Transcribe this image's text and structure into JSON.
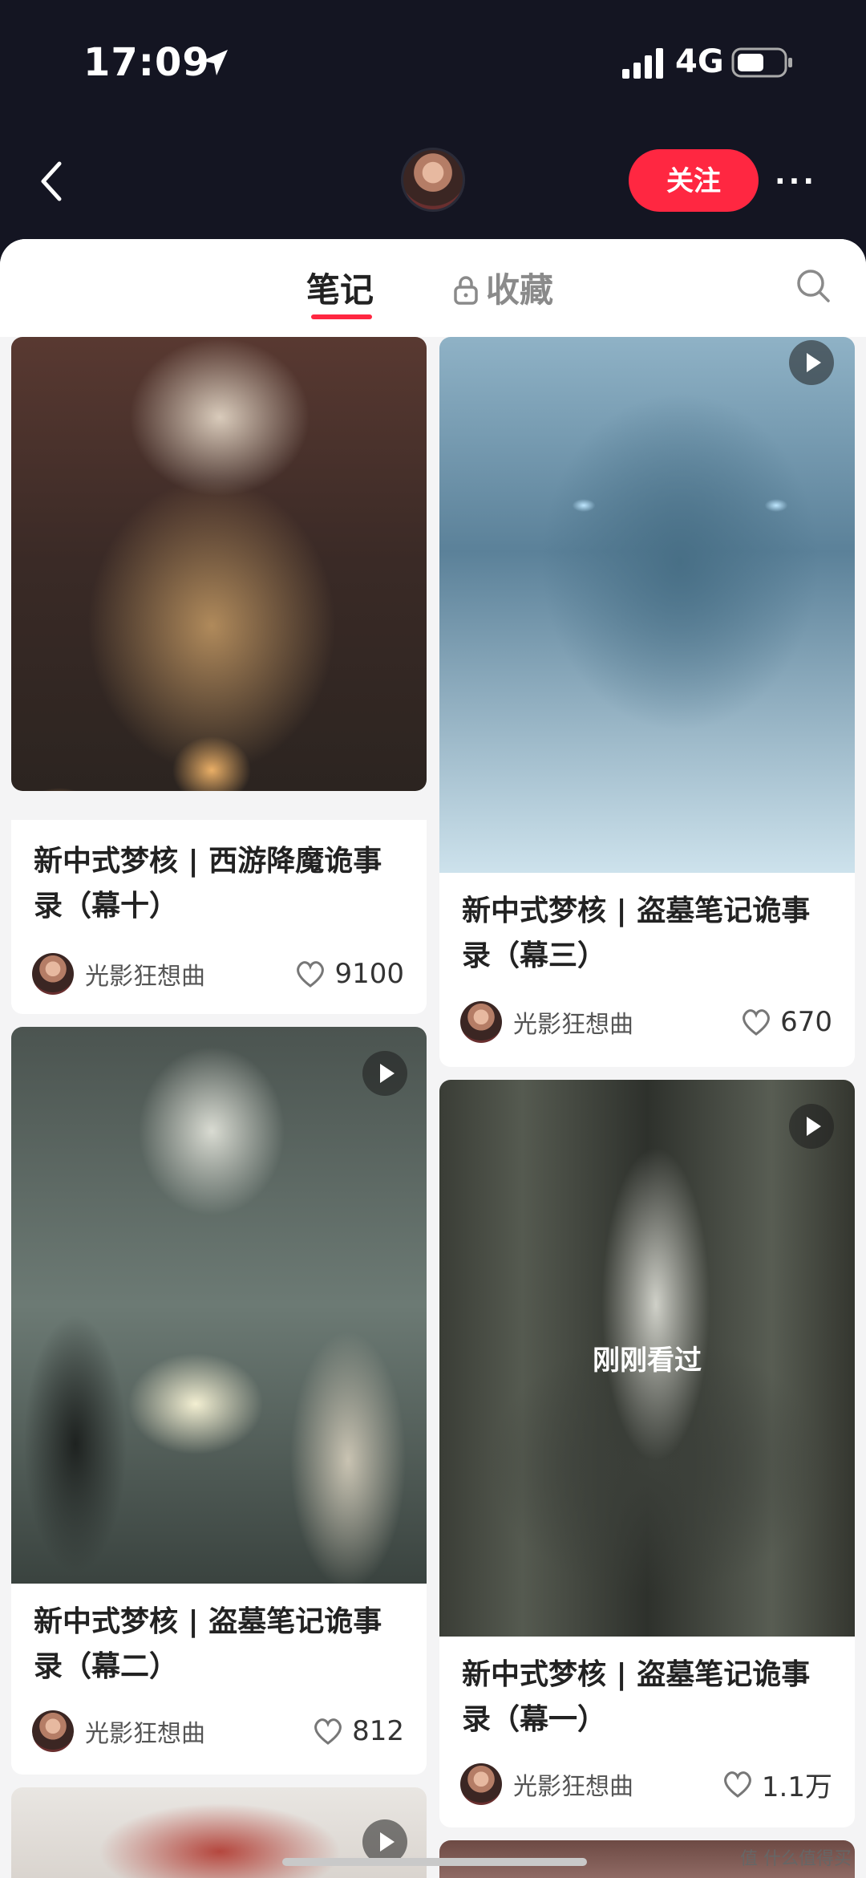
{
  "status": {
    "time": "17:09",
    "network": "4G"
  },
  "nav": {
    "follow_label": "关注",
    "more_label": "···"
  },
  "tabs": {
    "notes": "笔记",
    "favorites": "收藏"
  },
  "cards": [
    {
      "title": "新中式梦核 | 西游降魔诡事录（幕十）",
      "author": "光影狂想曲",
      "likes": "9100",
      "is_video": false
    },
    {
      "title": "新中式梦核 | 盗墓笔记诡事录（幕三）",
      "author": "光影狂想曲",
      "likes": "670",
      "is_video": true
    },
    {
      "title": "新中式梦核 | 盗墓笔记诡事录（幕二）",
      "author": "光影狂想曲",
      "likes": "812",
      "is_video": true
    },
    {
      "title": "新中式梦核 | 盗墓笔记诡事录（幕一）",
      "author": "光影狂想曲",
      "likes": "1.1万",
      "is_video": true,
      "overlay": "刚刚看过"
    }
  ],
  "watermark": "值 什么值得买",
  "colors": {
    "accent": "#ff2741",
    "topbar": "#141522"
  }
}
